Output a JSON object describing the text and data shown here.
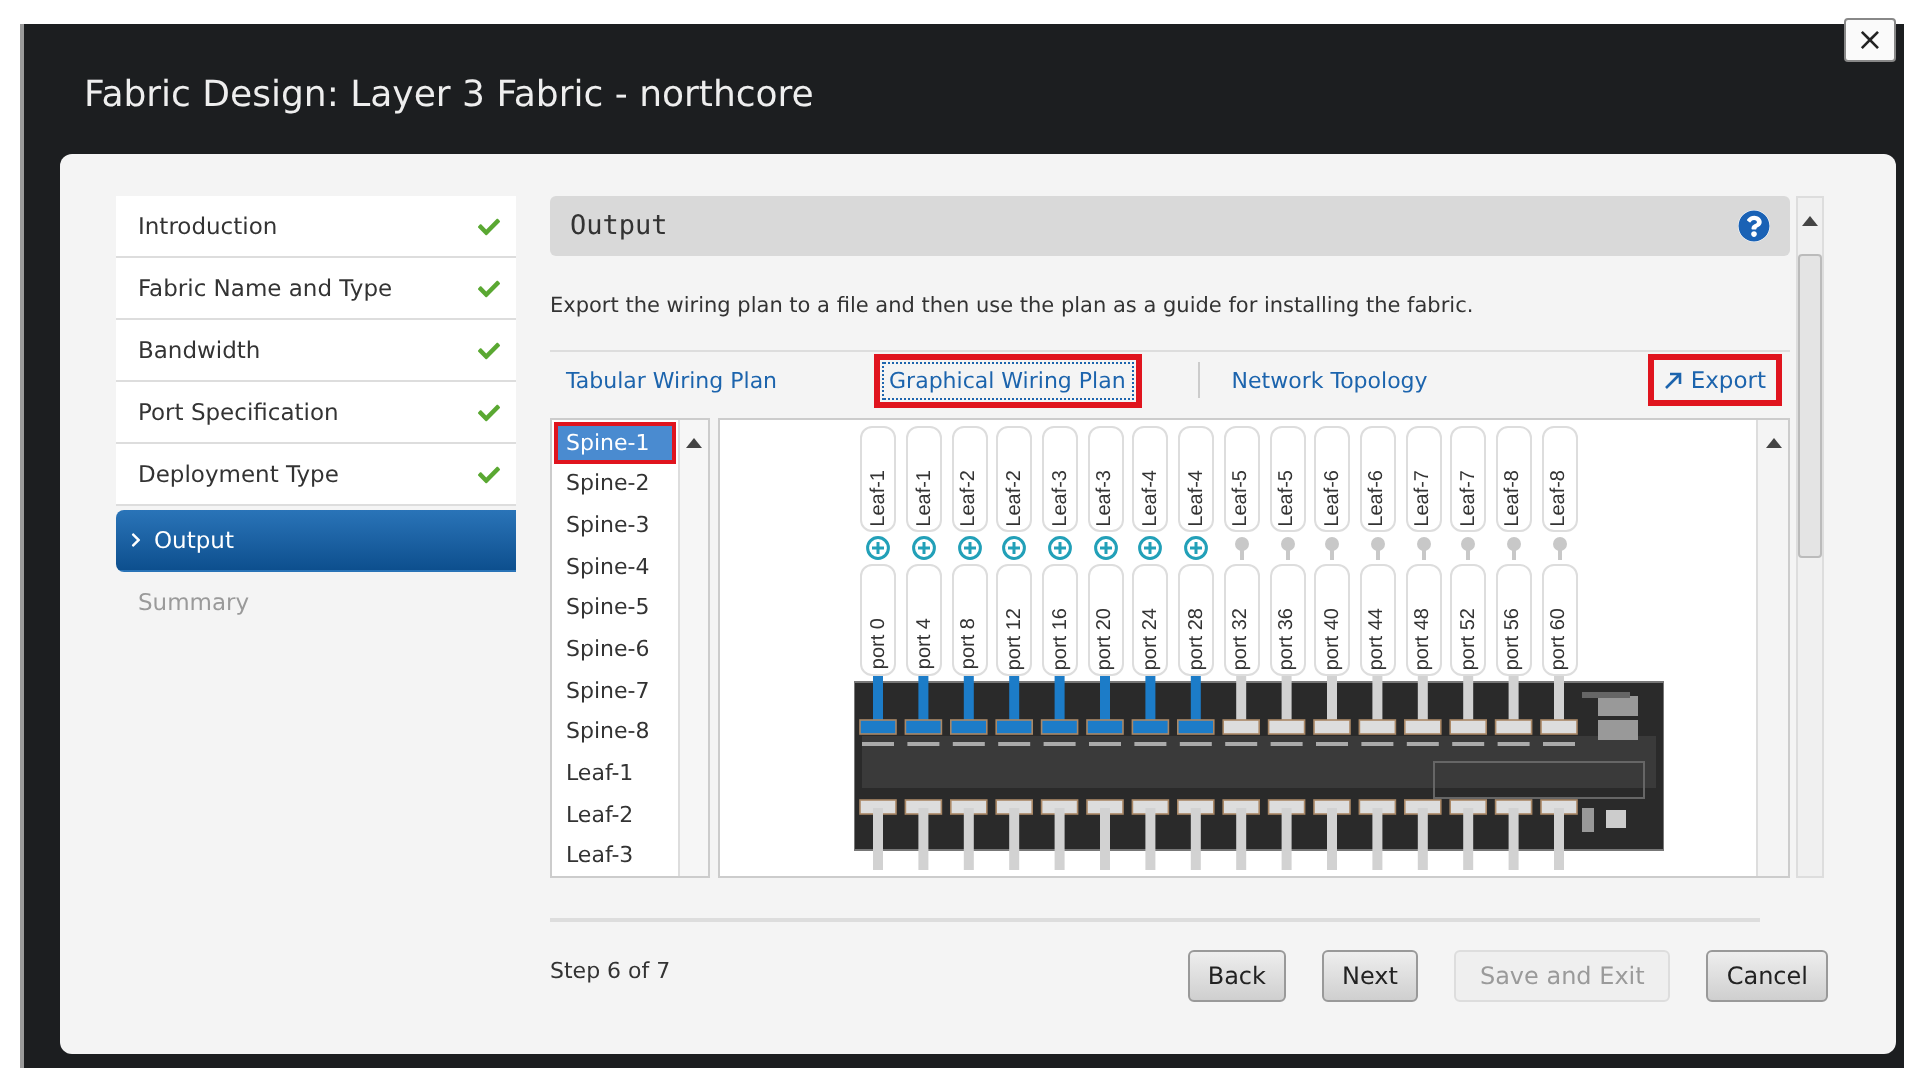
{
  "window": {
    "title": "Fabric Design: Layer 3 Fabric - northcore",
    "close_glyph": "×"
  },
  "steps": [
    {
      "label": "Introduction",
      "completed": true,
      "selected": false,
      "disabled": false
    },
    {
      "label": "Fabric Name and Type",
      "completed": true,
      "selected": false,
      "disabled": false
    },
    {
      "label": "Bandwidth",
      "completed": true,
      "selected": false,
      "disabled": false
    },
    {
      "label": "Port Specification",
      "completed": true,
      "selected": false,
      "disabled": false
    },
    {
      "label": "Deployment Type",
      "completed": true,
      "selected": false,
      "disabled": false
    },
    {
      "label": "Output",
      "completed": false,
      "selected": true,
      "disabled": false
    },
    {
      "label": "Summary",
      "completed": false,
      "selected": false,
      "disabled": true
    }
  ],
  "section": {
    "title": "Output",
    "description": "Export the wiring plan to a file and then use the plan as a guide for installing the fabric."
  },
  "tabs": [
    {
      "label": "Tabular Wiring Plan",
      "selected": false,
      "highlighted": false
    },
    {
      "label": "Graphical Wiring Plan",
      "selected": true,
      "highlighted": true
    },
    {
      "label": "Network Topology",
      "selected": false,
      "highlighted": false
    }
  ],
  "export": {
    "label": "Export",
    "highlighted": true
  },
  "switches": [
    {
      "label": "Spine-1",
      "selected": true,
      "highlighted": true
    },
    {
      "label": "Spine-2",
      "selected": false,
      "highlighted": false
    },
    {
      "label": "Spine-3",
      "selected": false,
      "highlighted": false
    },
    {
      "label": "Spine-4",
      "selected": false,
      "highlighted": false
    },
    {
      "label": "Spine-5",
      "selected": false,
      "highlighted": false
    },
    {
      "label": "Spine-6",
      "selected": false,
      "highlighted": false
    },
    {
      "label": "Spine-7",
      "selected": false,
      "highlighted": false
    },
    {
      "label": "Spine-8",
      "selected": false,
      "highlighted": false
    },
    {
      "label": "Leaf-1",
      "selected": false,
      "highlighted": false
    },
    {
      "label": "Leaf-2",
      "selected": false,
      "highlighted": false
    },
    {
      "label": "Leaf-3",
      "selected": false,
      "highlighted": false
    }
  ],
  "ports": [
    {
      "leaf": "Leaf-1",
      "port": "port 0",
      "connected": true
    },
    {
      "leaf": "Leaf-1",
      "port": "port 4",
      "connected": true
    },
    {
      "leaf": "Leaf-2",
      "port": "port 8",
      "connected": true
    },
    {
      "leaf": "Leaf-2",
      "port": "port 12",
      "connected": true
    },
    {
      "leaf": "Leaf-3",
      "port": "port 16",
      "connected": true
    },
    {
      "leaf": "Leaf-3",
      "port": "port 20",
      "connected": true
    },
    {
      "leaf": "Leaf-4",
      "port": "port 24",
      "connected": true
    },
    {
      "leaf": "Leaf-4",
      "port": "port 28",
      "connected": true
    },
    {
      "leaf": "Leaf-5",
      "port": "port 32",
      "connected": false
    },
    {
      "leaf": "Leaf-5",
      "port": "port 36",
      "connected": false
    },
    {
      "leaf": "Leaf-6",
      "port": "port 40",
      "connected": false
    },
    {
      "leaf": "Leaf-6",
      "port": "port 44",
      "connected": false
    },
    {
      "leaf": "Leaf-7",
      "port": "port 48",
      "connected": false
    },
    {
      "leaf": "Leaf-7",
      "port": "port 52",
      "connected": false
    },
    {
      "leaf": "Leaf-8",
      "port": "port 56",
      "connected": false
    },
    {
      "leaf": "Leaf-8",
      "port": "port 60",
      "connected": false
    }
  ],
  "footer": {
    "step": "Step 6 of 7",
    "buttons": [
      {
        "label": "Back",
        "disabled": false
      },
      {
        "label": "Next",
        "disabled": false
      },
      {
        "label": "Save and Exit",
        "disabled": true
      },
      {
        "label": "Cancel",
        "disabled": false
      }
    ]
  }
}
